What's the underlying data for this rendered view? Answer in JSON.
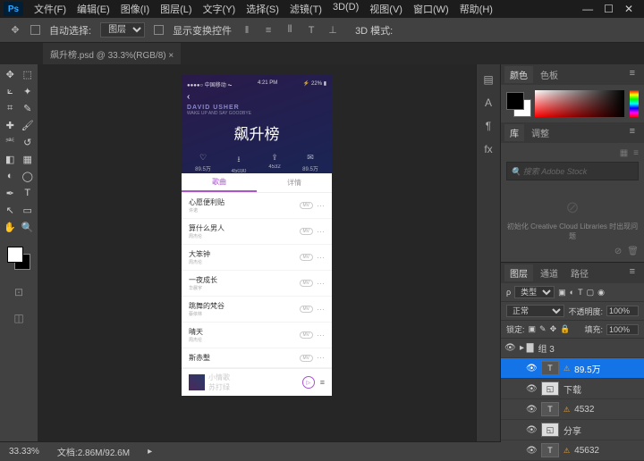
{
  "menubar": [
    "文件(F)",
    "编辑(E)",
    "图像(I)",
    "图层(L)",
    "文字(Y)",
    "选择(S)",
    "滤镜(T)",
    "3D(D)",
    "视图(V)",
    "窗口(W)",
    "帮助(H)"
  ],
  "options": {
    "auto_select": "自动选择:",
    "layer_sel": "图层",
    "show_transform": "显示变换控件",
    "mode3d": "3D 模式:"
  },
  "tab": "飙升榜.psd @ 33.3%(RGB/8) ×",
  "art": {
    "status": {
      "time": "4:21 PM",
      "bat": "22%",
      "sig": "●●●●○  中国移动  ⏦"
    },
    "back": "‹",
    "artist": "DAVID USHER",
    "sub": "WAKE UP AND SAY GOODBYE",
    "title": "飙升榜",
    "stats": [
      {
        "ic": "♡",
        "v": "89.5万"
      },
      {
        "ic": "⭳",
        "v": "45030"
      },
      {
        "ic": "⇪",
        "v": "4532"
      },
      {
        "ic": "✉",
        "v": "89.5万"
      }
    ],
    "tabs": [
      "歌曲",
      "详情"
    ],
    "songs": [
      {
        "t": "心愿便利贴",
        "a": "许诺"
      },
      {
        "t": "算什么男人",
        "a": "周杰伦"
      },
      {
        "t": "大笨钟",
        "a": "周杰伦"
      },
      {
        "t": "一夜成长",
        "a": "华晨宇"
      },
      {
        "t": "跳舞的梵谷",
        "a": "蔡依林"
      },
      {
        "t": "晴天",
        "a": "周杰伦"
      },
      {
        "t": "斯赤墼",
        "a": ""
      }
    ],
    "player": {
      "t": "小情歌",
      "a": "苏打绿"
    }
  },
  "panels": {
    "color": [
      "颜色",
      "色板"
    ],
    "lib": {
      "tabs": [
        "库",
        "调整"
      ],
      "search": "搜索 Adobe Stock",
      "text": "初始化 Creative Cloud Libraries 时出现问题"
    },
    "layers": {
      "tabs": [
        "图层",
        "通道",
        "路径"
      ],
      "kind": "类型",
      "blend": "正常",
      "opacity_l": "不透明度:",
      "opacity_v": "100%",
      "lock": "锁定:",
      "fill_l": "填充:",
      "fill_v": "100%",
      "items": [
        {
          "name": "组 3",
          "type": "group",
          "ind": 0
        },
        {
          "name": "89.5万",
          "type": "text",
          "ind": 2,
          "sel": true
        },
        {
          "name": "下载",
          "type": "shape",
          "ind": 2
        },
        {
          "name": "4532",
          "type": "text",
          "ind": 2
        },
        {
          "name": "分享",
          "type": "shape",
          "ind": 2
        },
        {
          "name": "45632",
          "type": "text",
          "ind": 2
        }
      ]
    }
  },
  "status": {
    "zoom": "33.33%",
    "doc": "文档:2.86M/92.6M"
  }
}
